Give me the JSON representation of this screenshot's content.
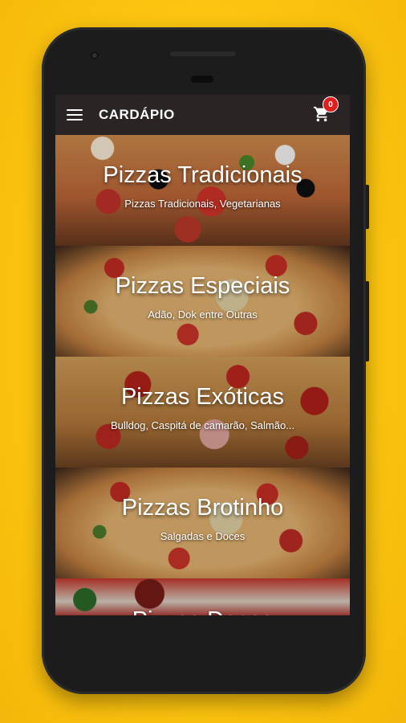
{
  "appbar": {
    "title": "CARDÁPIO",
    "cart_count": "0",
    "menu_icon": "hamburger-menu-icon",
    "cart_icon": "shopping-cart-icon"
  },
  "categories": [
    {
      "title": "Pizzas Tradicionais",
      "subtitle": "Pizzas Tradicionais, Vegetarianas"
    },
    {
      "title": "Pizzas Especiais",
      "subtitle": "Adão, Dok entre Outras"
    },
    {
      "title": "Pizzas Exóticas",
      "subtitle": "Bulldog, Caspitá de camarão, Salmão..."
    },
    {
      "title": "Pizzas Brotinho",
      "subtitle": "Salgadas e Doces"
    },
    {
      "title": "Pizzas Doces",
      "subtitle": ""
    }
  ],
  "colors": {
    "background": "#fbc40f",
    "appbar": "#2a2524",
    "badge": "#e01e1e"
  }
}
